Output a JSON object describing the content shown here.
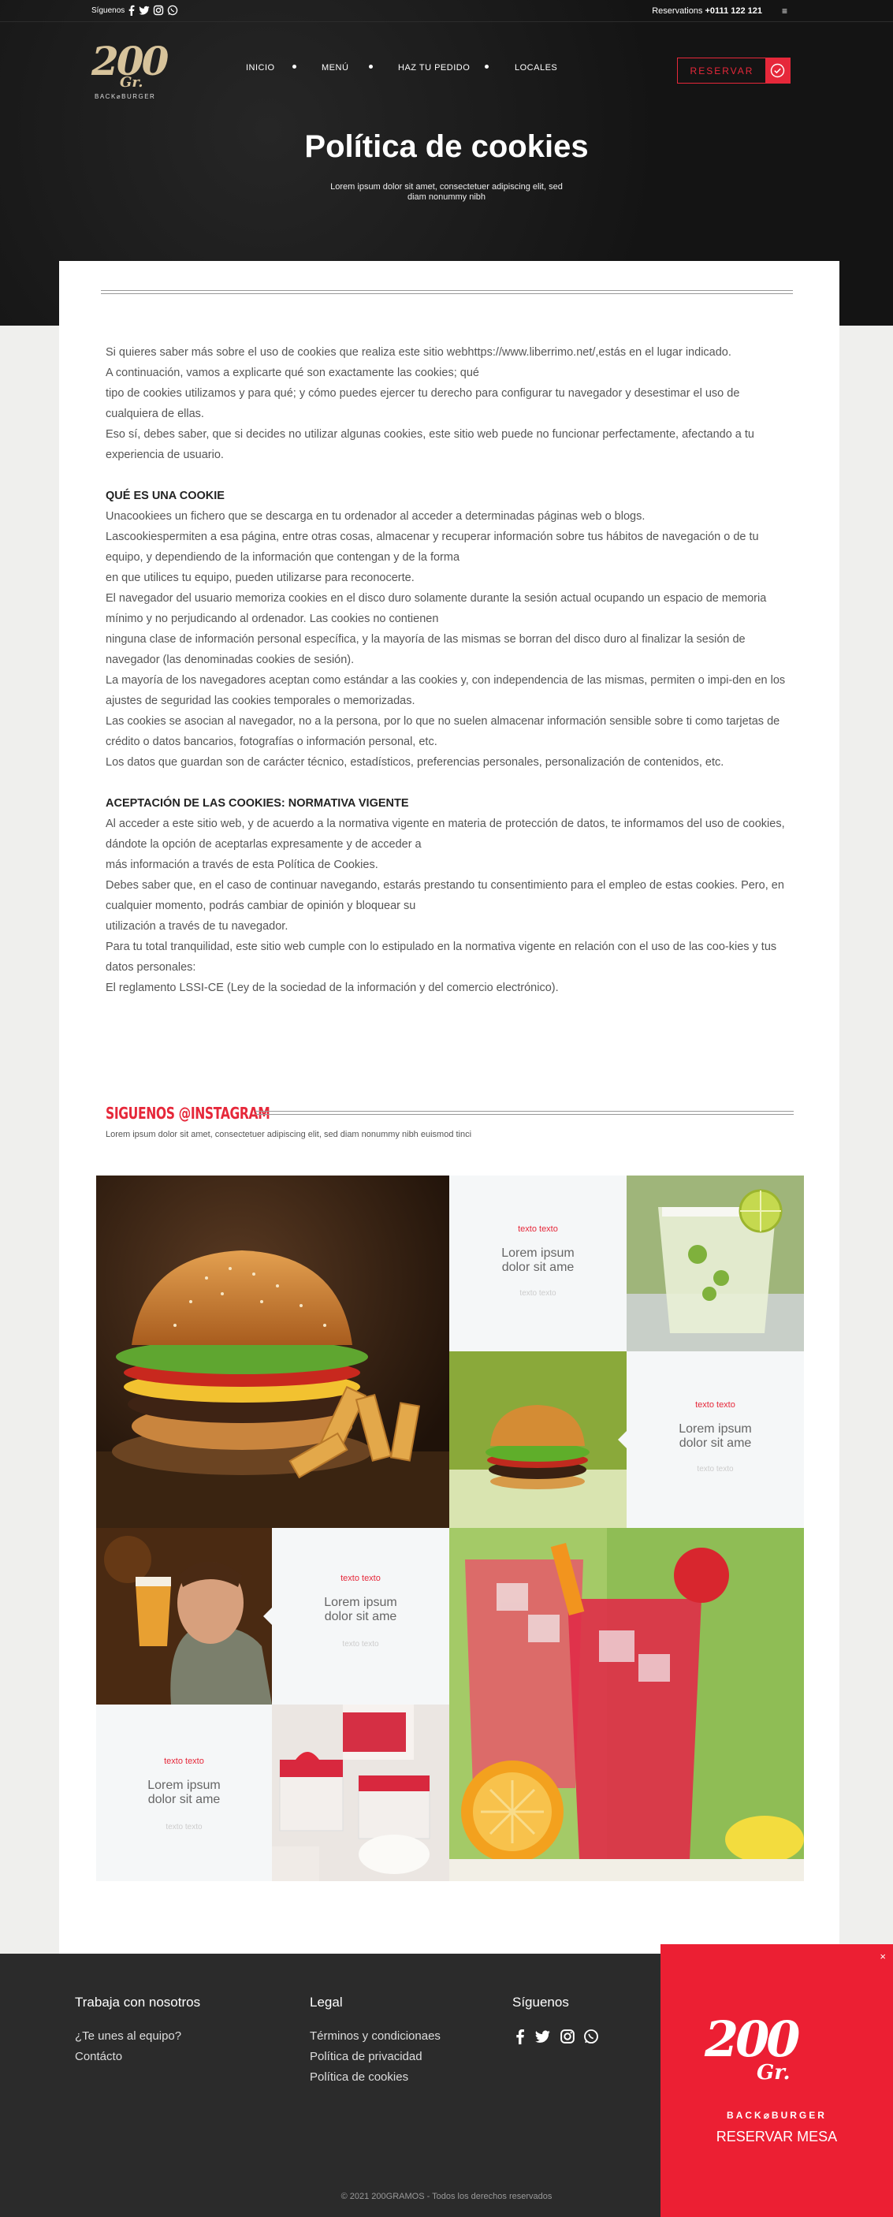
{
  "topbar": {
    "follow_label": "Síguenos",
    "reservations_label": "Reservations",
    "reservations_phone": "+0111 122 121",
    "menu_glyph": "≡"
  },
  "logo": {
    "number": "200",
    "gr": "Gr.",
    "tagline": "BACK⌀BURGER"
  },
  "nav": {
    "items": [
      "INICIO",
      "MENÚ",
      "HAZ TU PEDIDO",
      "LOCALES"
    ]
  },
  "reserve_button": "RESERVAR",
  "hero": {
    "title": "Política de cookies",
    "subtitle": "Lorem ipsum dolor sit amet, consectetuer adipiscing elit, sed diam nonummy nibh"
  },
  "content": {
    "intro": [
      "Si quieres saber más sobre el uso de cookies que realiza este sitio webhttps://www.liberrimo.net/,estás en el lugar indicado.",
      "A continuación, vamos a explicarte qué son exactamente las cookies; qué",
      "tipo de cookies utilizamos y para qué; y cómo puedes ejercer tu derecho para configurar tu navegador y desestimar el uso de cualquiera de ellas.",
      "Eso sí, debes saber, que si decides no utilizar algunas cookies, este sitio web puede no funcionar perfectamente, afectando a tu experiencia de usuario."
    ],
    "section1_title": "QUÉ ES UNA COOKIE",
    "section1": [
      "Unacookiees un fichero que se descarga en tu ordenador al acceder a determinadas páginas web o blogs.",
      "Lascookiespermiten a esa página, entre otras cosas, almacenar y recuperar información sobre tus hábitos de navegación o de tu equipo, y dependiendo de la información que contengan y de la forma",
      "en que utilices tu equipo, pueden utilizarse para reconocerte.",
      "El navegador del usuario memoriza cookies en el disco duro solamente durante la sesión actual ocupando un espacio de memoria mínimo y no perjudicando al ordenador. Las cookies no contienen",
      "ninguna clase de información personal específica, y la mayoría de las mismas se borran del disco duro al finalizar la sesión de navegador (las denominadas cookies de sesión).",
      "La mayoría de los navegadores aceptan como estándar a las cookies y, con independencia de las mismas, permiten o impi-den en los ajustes de seguridad las cookies temporales o memorizadas.",
      "Las cookies se asocian al navegador, no a la persona, por lo que no suelen almacenar información sensible sobre ti como tarjetas de crédito o datos bancarios, fotografías o información personal, etc.",
      "Los datos que guardan son de carácter técnico, estadísticos, preferencias personales, personalización de contenidos, etc."
    ],
    "section2_title": "ACEPTACIÓN DE LAS COOKIES: NORMATIVA VIGENTE",
    "section2": [
      "Al acceder a este sitio web, y de acuerdo a la normativa vigente en materia de protección de datos, te informamos del uso de cookies, dándote la opción de aceptarlas expresamente y de acceder a",
      "más información a través de esta Política de Cookies.",
      "Debes saber que, en el caso de continuar navegando, estarás prestando tu consentimiento para el empleo de estas cookies. Pero, en cualquier momento, podrás cambiar de opinión y bloquear su",
      "utilización a través de tu navegador.",
      "Para tu total tranquilidad, este sitio web cumple con lo estipulado en la normativa vigente en relación con el uso de las coo-kies y tus datos personales:",
      "El reglamento LSSI-CE (Ley de la sociedad de la información y del comercio electrónico)."
    ]
  },
  "instagram": {
    "title": "SIGUENOS @INSTAGRAM",
    "subtitle": "Lorem ipsum dolor sit amet, consectetuer adipiscing elit, sed diam nonummy nibh euismod tinci",
    "tiles": [
      {
        "tag": "texto texto",
        "label": "Lorem ipsum dolor sit ame",
        "foot": "texto texto"
      },
      {
        "tag": "texto texto",
        "label": "Lorem ipsum dolor sit ame",
        "foot": "texto texto"
      },
      {
        "tag": "texto texto",
        "label": "Lorem ipsum dolor sit ame",
        "foot": "texto texto"
      },
      {
        "tag": "texto texto",
        "label": "Lorem ipsum dolor sit ame",
        "foot": "texto texto"
      }
    ]
  },
  "footer": {
    "col1_title": "Trabaja con nosotros",
    "col1_links": [
      "¿Te unes al equipo?",
      "Contácto"
    ],
    "col2_title": "Legal",
    "col2_links": [
      "Términos y condicionaes",
      "Política de privacidad",
      "Política de cookies"
    ],
    "col3_title": "Síguenos",
    "social_icons": [
      "facebook-icon",
      "twitter-icon",
      "instagram-icon",
      "whatsapp-icon"
    ],
    "copyright": "© 2021 200GRAMOS - Todos los derechos reservados"
  },
  "popup": {
    "close": "×",
    "number": "200",
    "gr": "Gr.",
    "tagline": "BACK⌀BURGER",
    "cta": "RESERVAR MESA"
  },
  "colors": {
    "accent": "#e6283a",
    "dark": "#141414",
    "footer": "#2b2b2b",
    "popup": "#ec1f33"
  }
}
